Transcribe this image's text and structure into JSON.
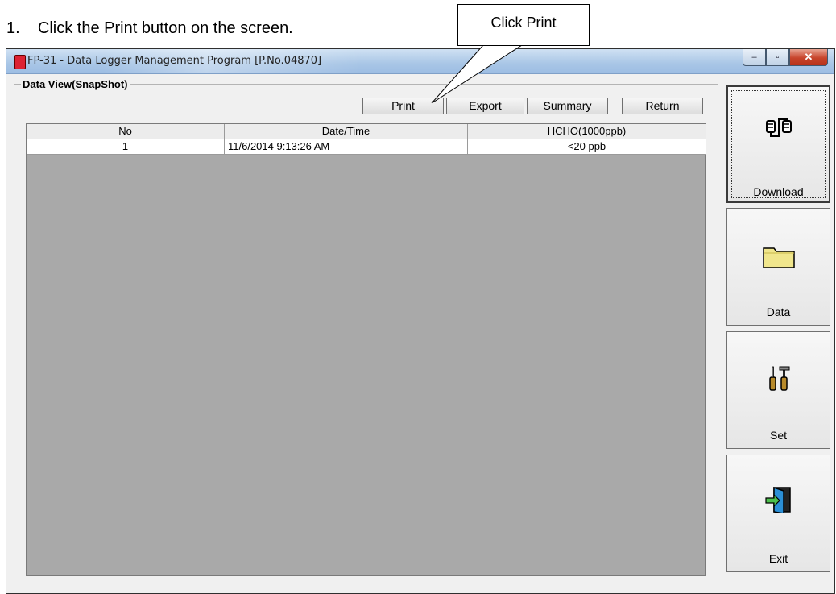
{
  "instruction": "1.    Click the Print button on the screen.",
  "callout": {
    "text": "Click Print"
  },
  "window": {
    "title": "FP-31  - Data Logger Management Program [P.No.04870]",
    "controls": {
      "minimize": "–",
      "maximize": "▫",
      "close": "✕"
    }
  },
  "group": {
    "label": "Data View(SnapShot)"
  },
  "toolbar": {
    "print": "Print",
    "export": "Export",
    "summary": "Summary",
    "return": "Return"
  },
  "table": {
    "headers": [
      "No",
      "Date/Time",
      "HCHO(1000ppb)"
    ],
    "rows": [
      [
        "1",
        "11/6/2014 9:13:26 AM",
        "<20  ppb"
      ]
    ]
  },
  "side_buttons": {
    "download": "Download",
    "data": "Data",
    "set": "Set",
    "exit": "Exit"
  },
  "icons": {
    "download": "download-connector-icon",
    "data": "folder-icon",
    "set": "tools-icon",
    "exit": "exit-door-icon"
  }
}
